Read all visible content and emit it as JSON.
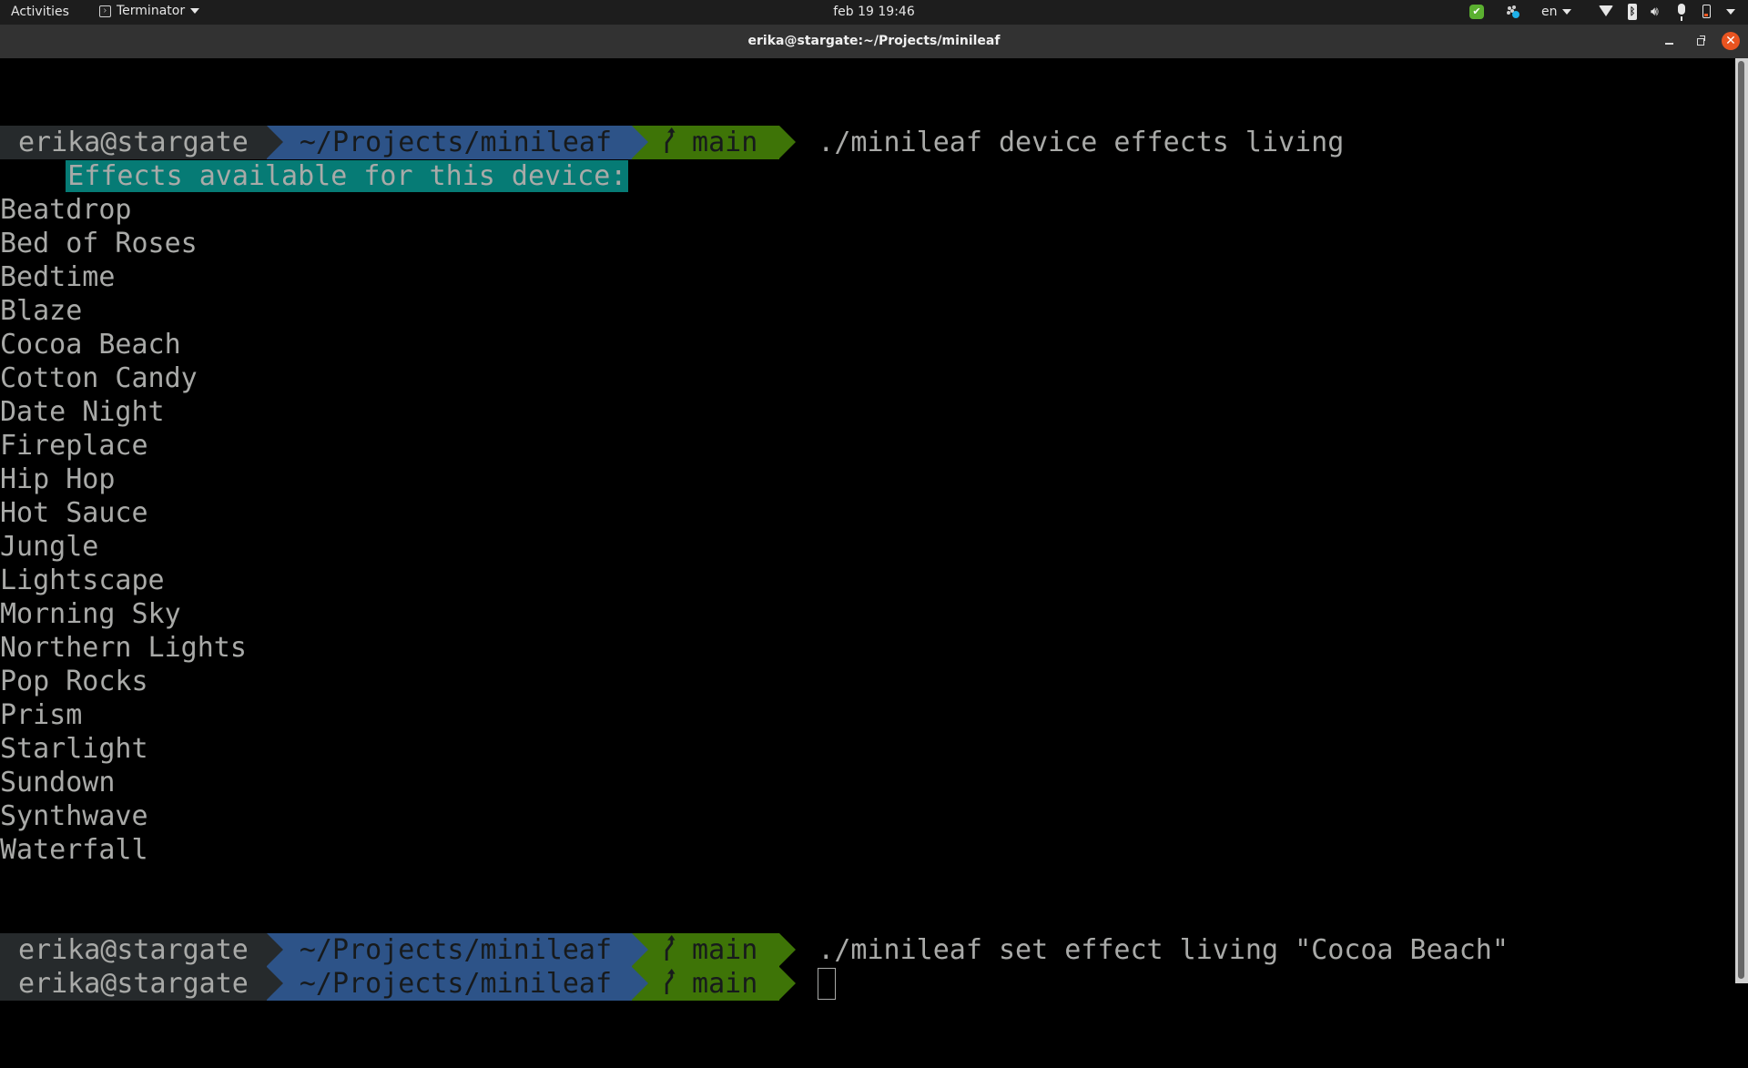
{
  "topbar": {
    "activities": "Activities",
    "app_name": "Terminator",
    "clock": "feb 19  19:46",
    "language": "en",
    "indicators": [
      "check-icon",
      "slack-icon",
      "wifi-icon",
      "bluetooth-icon",
      "volume-icon",
      "microphone-icon",
      "battery-icon",
      "system-menu-icon"
    ],
    "battery_color": "#f15a24"
  },
  "window": {
    "title": "erika@stargate:~/Projects/minileaf",
    "close_color": "#e95420"
  },
  "prompt": {
    "user_host": "erika@stargate",
    "path": "~/Projects/minileaf",
    "branch": "main",
    "colors": {
      "user_bg": "#262a2c",
      "path_bg": "#2d5388",
      "git_bg": "#3e7407"
    }
  },
  "terminal": {
    "command1": "./minileaf device effects living",
    "banner": "Effects available for this device:",
    "banner_bg": "#067b75",
    "effects": [
      "Beatdrop",
      "Bed of Roses",
      "Bedtime",
      "Blaze",
      "Cocoa Beach",
      "Cotton Candy",
      "Date Night",
      "Fireplace",
      "Hip Hop",
      "Hot Sauce",
      "Jungle",
      "Lightscape",
      "Morning Sky",
      "Northern Lights",
      "Pop Rocks",
      "Prism",
      "Starlight",
      "Sundown",
      "Synthwave",
      "Waterfall"
    ],
    "command2": "./minileaf set effect living \"Cocoa Beach\"",
    "command3": ""
  }
}
